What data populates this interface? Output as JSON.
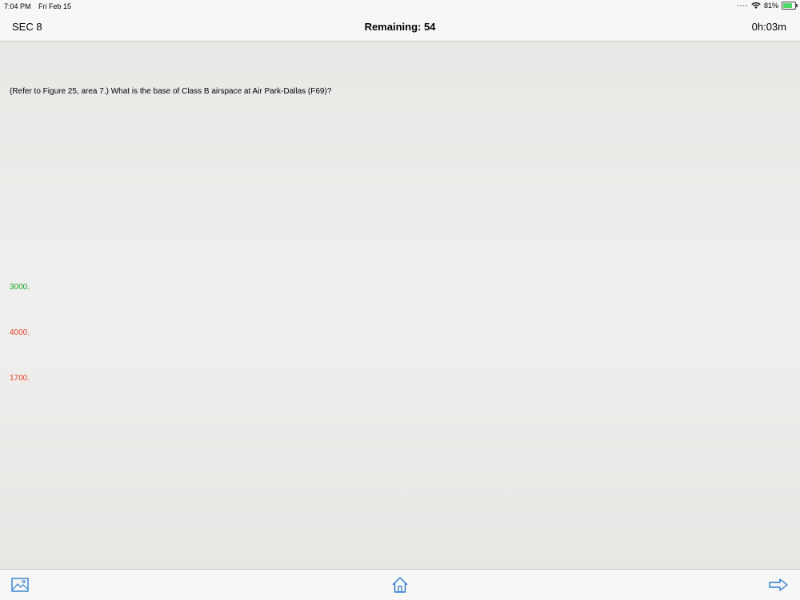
{
  "status_bar": {
    "time": "7:04 PM",
    "date": "Fri Feb 15",
    "battery": "81%",
    "battery_level": 0.81
  },
  "nav": {
    "left_label": "SEC 8",
    "title": "Remaining: 54",
    "timer": "0h:03m"
  },
  "question": {
    "text": "(Refer to Figure 25, area 7.) What is the base of Class B airspace at Air Park-Dallas (F69)?"
  },
  "answers": [
    {
      "text": "3000.",
      "color": "#1aa32a"
    },
    {
      "text": "4000.",
      "color": "#e8432d"
    },
    {
      "text": "1700.",
      "color": "#e8432d"
    }
  ],
  "toolbar": {
    "icons": [
      "image-icon",
      "home-icon",
      "arrow-right-icon"
    ],
    "accent": "#2f7dd1"
  }
}
